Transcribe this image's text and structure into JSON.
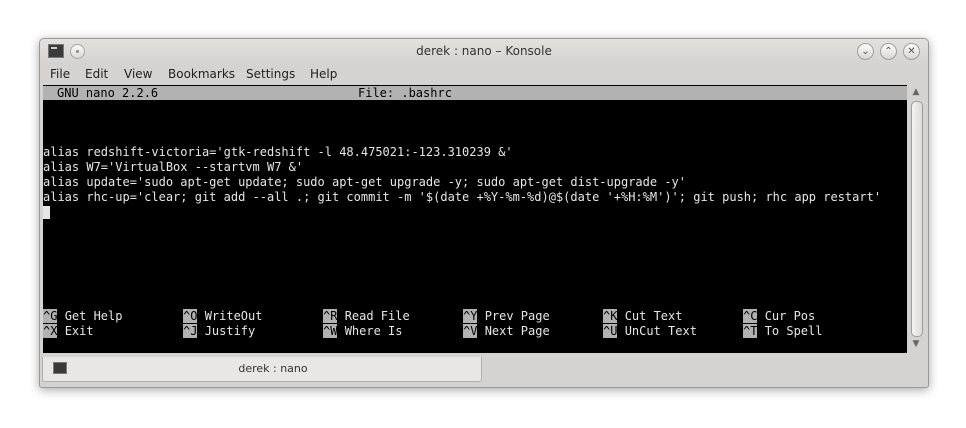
{
  "window": {
    "title": "derek : nano – Konsole",
    "controls": {
      "minimize": "⌄",
      "maximize": "⌃",
      "close": "✕"
    }
  },
  "menubar": [
    "File",
    "Edit",
    "View",
    "Bookmarks",
    "Settings",
    "Help"
  ],
  "nano": {
    "version": "GNU nano 2.2.6",
    "file": "File: .bashrc",
    "lines": [
      "",
      "",
      "",
      "alias redshift-victoria='gtk-redshift -l 48.475021:-123.310239 &'",
      "alias W7='VirtualBox --startvm W7 &'",
      "alias update='sudo apt-get update; sudo apt-get upgrade -y; sudo apt-get dist-upgrade -y'",
      "alias rhc-up='clear; git add --all .; git commit -m '$(date +%Y-%m-%d)@$(date '+%H:%M')'; git push; rhc app restart'"
    ],
    "shortcuts_row1": [
      {
        "key": "^G",
        "label": "Get Help"
      },
      {
        "key": "^O",
        "label": "WriteOut"
      },
      {
        "key": "^R",
        "label": "Read File"
      },
      {
        "key": "^Y",
        "label": "Prev Page"
      },
      {
        "key": "^K",
        "label": "Cut Text"
      },
      {
        "key": "^C",
        "label": "Cur Pos"
      }
    ],
    "shortcuts_row2": [
      {
        "key": "^X",
        "label": "Exit"
      },
      {
        "key": "^J",
        "label": "Justify"
      },
      {
        "key": "^W",
        "label": "Where Is"
      },
      {
        "key": "^V",
        "label": "Next Page"
      },
      {
        "key": "^U",
        "label": "UnCut Text"
      },
      {
        "key": "^T",
        "label": "To Spell"
      }
    ]
  },
  "tab": {
    "label": "derek : nano"
  },
  "colors": {
    "terminal_bg": "#000000",
    "terminal_fg": "#e6e6e6",
    "nano_bar": "#b2b2b2",
    "window_chrome": "#d6d2d0"
  },
  "icons": {
    "window_icon": "terminal-icon",
    "pin": "pin-icon",
    "scroll_up": "arrow-up-icon",
    "scroll_down": "arrow-down-icon"
  }
}
